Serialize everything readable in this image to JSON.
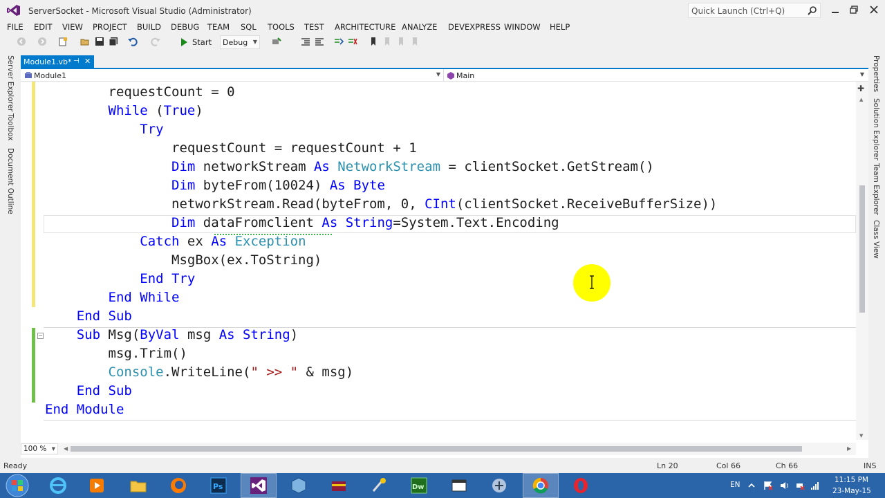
{
  "window": {
    "title": "ServerSocket - Microsoft Visual Studio (Administrator)",
    "quick_launch_placeholder": "Quick Launch (Ctrl+Q)"
  },
  "menu": [
    "FILE",
    "EDIT",
    "VIEW",
    "PROJECT",
    "BUILD",
    "DEBUG",
    "TEAM",
    "SQL",
    "TOOLS",
    "TEST",
    "ARCHITECTURE",
    "ANALYZE",
    "DEVEXPRESS",
    "WINDOW",
    "HELP"
  ],
  "toolbar": {
    "start_label": "Start",
    "configuration": "Debug"
  },
  "left_tool_tabs": [
    "Server Explorer",
    "Toolbox",
    "Document Outline"
  ],
  "right_tool_tabs": [
    "Properties",
    "Solution Explorer",
    "Team Explorer",
    "Class View"
  ],
  "document_tab": {
    "label": "Module1.vb*",
    "pin_glyph": "⊣",
    "close_glyph": "✕"
  },
  "navigation": {
    "type": "Module1",
    "member": "Main"
  },
  "code": {
    "lines": [
      [
        {
          "t": "        requestCount = 0",
          "c": "pl"
        }
      ],
      [
        {
          "t": "        ",
          "c": "pl"
        },
        {
          "t": "While",
          "c": "kw"
        },
        {
          "t": " (",
          "c": "pl"
        },
        {
          "t": "True",
          "c": "kw"
        },
        {
          "t": ")",
          "c": "pl"
        }
      ],
      [
        {
          "t": "            ",
          "c": "pl"
        },
        {
          "t": "Try",
          "c": "kw"
        }
      ],
      [
        {
          "t": "                requestCount = requestCount + 1",
          "c": "pl"
        }
      ],
      [
        {
          "t": "                ",
          "c": "pl"
        },
        {
          "t": "Dim",
          "c": "kw"
        },
        {
          "t": " networkStream ",
          "c": "pl"
        },
        {
          "t": "As",
          "c": "kw"
        },
        {
          "t": " ",
          "c": "pl"
        },
        {
          "t": "NetworkStream",
          "c": "ty"
        },
        {
          "t": " = clientSocket.GetStream()",
          "c": "pl"
        }
      ],
      [
        {
          "t": "                ",
          "c": "pl"
        },
        {
          "t": "Dim",
          "c": "kw"
        },
        {
          "t": " byteFrom(10024) ",
          "c": "pl"
        },
        {
          "t": "As",
          "c": "kw"
        },
        {
          "t": " ",
          "c": "pl"
        },
        {
          "t": "Byte",
          "c": "kw"
        }
      ],
      [
        {
          "t": "                networkStream.Read(byteFrom, 0, ",
          "c": "pl"
        },
        {
          "t": "CInt",
          "c": "kw"
        },
        {
          "t": "(clientSocket.ReceiveBufferSize))",
          "c": "pl"
        }
      ],
      [
        {
          "t": "                ",
          "c": "pl"
        },
        {
          "t": "Dim",
          "c": "kw"
        },
        {
          "t": " dataFromclient ",
          "c": "pl"
        },
        {
          "t": "As",
          "c": "kw"
        },
        {
          "t": " ",
          "c": "pl"
        },
        {
          "t": "String",
          "c": "kw"
        },
        {
          "t": "=System.Text.Encoding",
          "c": "pl"
        }
      ],
      [
        {
          "t": "            ",
          "c": "pl"
        },
        {
          "t": "Catch",
          "c": "kw"
        },
        {
          "t": " ex ",
          "c": "pl"
        },
        {
          "t": "As",
          "c": "kw"
        },
        {
          "t": " ",
          "c": "pl"
        },
        {
          "t": "Exception",
          "c": "ty"
        }
      ],
      [
        {
          "t": "                MsgBox(ex.ToString)",
          "c": "pl"
        }
      ],
      [
        {
          "t": "            ",
          "c": "pl"
        },
        {
          "t": "End Try",
          "c": "kw"
        }
      ],
      [
        {
          "t": "        ",
          "c": "pl"
        },
        {
          "t": "End While",
          "c": "kw"
        }
      ],
      [
        {
          "t": "    ",
          "c": "pl"
        },
        {
          "t": "End Sub",
          "c": "kw"
        }
      ],
      [
        {
          "t": "    ",
          "c": "pl"
        },
        {
          "t": "Sub",
          "c": "kw"
        },
        {
          "t": " Msg(",
          "c": "pl"
        },
        {
          "t": "ByVal",
          "c": "kw"
        },
        {
          "t": " msg ",
          "c": "pl"
        },
        {
          "t": "As",
          "c": "kw"
        },
        {
          "t": " ",
          "c": "pl"
        },
        {
          "t": "String",
          "c": "kw"
        },
        {
          "t": ")",
          "c": "pl"
        }
      ],
      [
        {
          "t": "        msg.Trim()",
          "c": "pl"
        }
      ],
      [
        {
          "t": "        ",
          "c": "pl"
        },
        {
          "t": "Console",
          "c": "ty"
        },
        {
          "t": ".WriteLine(",
          "c": "pl"
        },
        {
          "t": "\" >> \"",
          "c": "st"
        },
        {
          "t": " & msg)",
          "c": "pl"
        }
      ],
      [
        {
          "t": "    ",
          "c": "pl"
        },
        {
          "t": "End Sub",
          "c": "kw"
        }
      ],
      [
        {
          "t": "End Module",
          "c": "kw"
        }
      ]
    ]
  },
  "editor": {
    "zoom": "100 %"
  },
  "status": {
    "state": "Ready",
    "line": "Ln 20",
    "column": "Col 66",
    "char": "Ch 66",
    "mode": "INS"
  },
  "taskbar": {
    "language": "EN",
    "time": "11:15 PM",
    "date": "23-May-15"
  },
  "colors": {
    "accent": "#007acc",
    "keyword": "#0000ff",
    "type": "#2b91af",
    "string": "#a31515",
    "changed_unsaved": "#f3e67a",
    "changed_saved": "#6fbf4a",
    "cursor_highlight": "#ffff00"
  }
}
